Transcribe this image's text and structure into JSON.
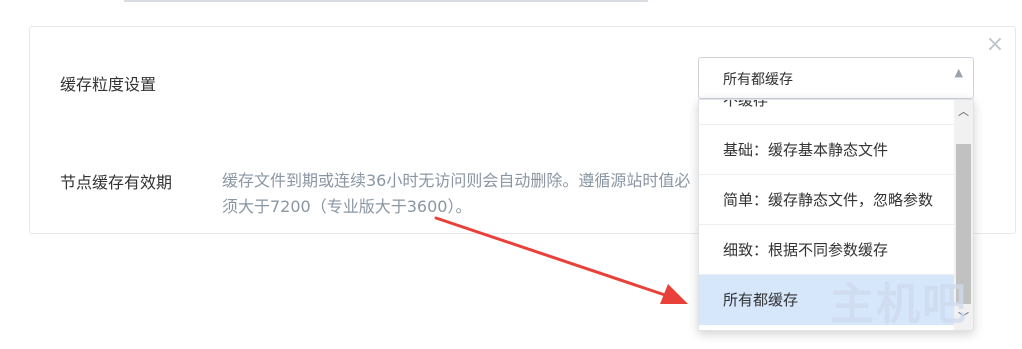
{
  "settings": {
    "granularity_label": "缓存粒度设置",
    "validity_label": "节点缓存有效期",
    "validity_description": "缓存文件到期或连续36小时无访问则会自动删除。遵循源站时值必须大于7200（专业版大于3600）。"
  },
  "select": {
    "value": "所有都缓存",
    "options": [
      "不缓存",
      "基础：缓存基本静态文件",
      "简单：缓存静态文件，忽略参数",
      "细致：根据不同参数缓存",
      "所有都缓存"
    ],
    "selected_index": 4
  },
  "icons": {
    "close": "close-icon",
    "select_arrow": "caret-up-icon",
    "scroll_up": "chevron-up-icon",
    "scroll_down": "chevron-down-icon",
    "annotation": "red-arrow-annotation"
  },
  "colors": {
    "selected_option": "#d6e6fb",
    "description_text": "#8a96a3",
    "annotation_arrow": "#e8413a"
  },
  "watermark": "主机吧"
}
